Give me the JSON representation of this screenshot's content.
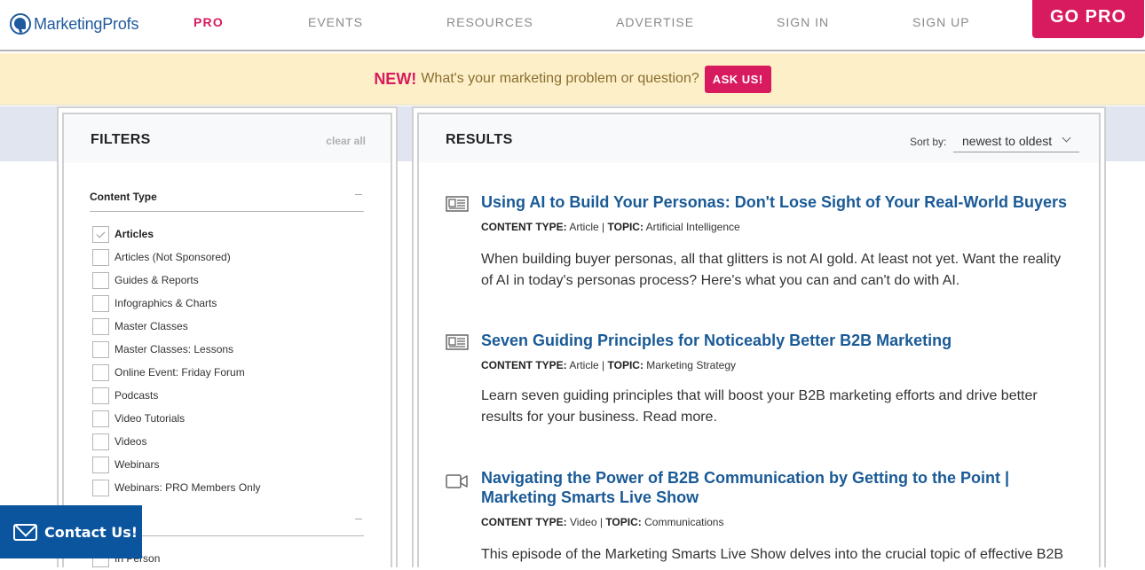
{
  "brand": {
    "logo_text": "MarketingProfs",
    "accent": "#d81b5e",
    "link_blue": "#1a5a96",
    "contact_blue": "#0b559e"
  },
  "nav": {
    "items": [
      {
        "label": "PRO"
      },
      {
        "label": "EVENTS"
      },
      {
        "label": "RESOURCES"
      },
      {
        "label": "ADVERTISE"
      },
      {
        "label": "SIGN IN"
      },
      {
        "label": "SIGN UP"
      }
    ],
    "cta_label": "GO PRO"
  },
  "announcement": {
    "badge": "NEW!",
    "message": "What's your marketing problem or question?",
    "button_label": "ASK US!"
  },
  "filters": {
    "title": "FILTERS",
    "clear_label": "clear all",
    "sections": [
      {
        "title": "Content Type",
        "toggle_icon": "minus",
        "options": [
          {
            "label": "Articles",
            "checked": true
          },
          {
            "label": "Articles (Not Sponsored)",
            "checked": false
          },
          {
            "label": "Guides & Reports",
            "checked": false
          },
          {
            "label": "Infographics & Charts",
            "checked": false
          },
          {
            "label": "Master Classes",
            "checked": false
          },
          {
            "label": "Master Classes: Lessons",
            "checked": false
          },
          {
            "label": "Online Event: Friday Forum",
            "checked": false
          },
          {
            "label": "Podcasts",
            "checked": false
          },
          {
            "label": "Video Tutorials",
            "checked": false
          },
          {
            "label": "Videos",
            "checked": false
          },
          {
            "label": "Webinars",
            "checked": false
          },
          {
            "label": "Webinars: PRO Members Only",
            "checked": false
          }
        ]
      },
      {
        "title": "",
        "toggle_icon": "minus",
        "options": [
          {
            "label": "In Person",
            "checked": false
          }
        ]
      }
    ]
  },
  "results": {
    "title": "RESULTS",
    "sort_label": "Sort by:",
    "sort_value": "newest to oldest",
    "items": [
      {
        "icon": "article-icon",
        "title": "Using AI to Build Your Personas: Don't Lose Sight of Your Real-World Buyers",
        "content_type_label": "CONTENT TYPE:",
        "content_type": "Article",
        "separator": "|",
        "topic_label": "TOPIC:",
        "topic": "Artificial Intelligence",
        "description": "When building buyer personas, all that glitters is not AI gold. At least not yet. Want the reality of AI in today's personas process? Here's what you can and can't do with AI."
      },
      {
        "icon": "article-icon",
        "title": "Seven Guiding Principles for Noticeably Better B2B Marketing",
        "content_type_label": "CONTENT TYPE:",
        "content_type": "Article",
        "separator": "|",
        "topic_label": "TOPIC:",
        "topic": "Marketing Strategy",
        "description": "Learn seven guiding principles that will boost your B2B marketing efforts and drive better results for your business. Read more."
      },
      {
        "icon": "video-icon",
        "title": "Navigating the Power of B2B Communication by Getting to the Point | Marketing Smarts Live Show",
        "content_type_label": "CONTENT TYPE:",
        "content_type": "Video",
        "separator": "|",
        "topic_label": "TOPIC:",
        "topic": "Communications",
        "description": "This episode of the Marketing Smarts Live Show delves into the crucial topic of effective B2B"
      }
    ]
  },
  "contact": {
    "label": "Contact Us!"
  }
}
